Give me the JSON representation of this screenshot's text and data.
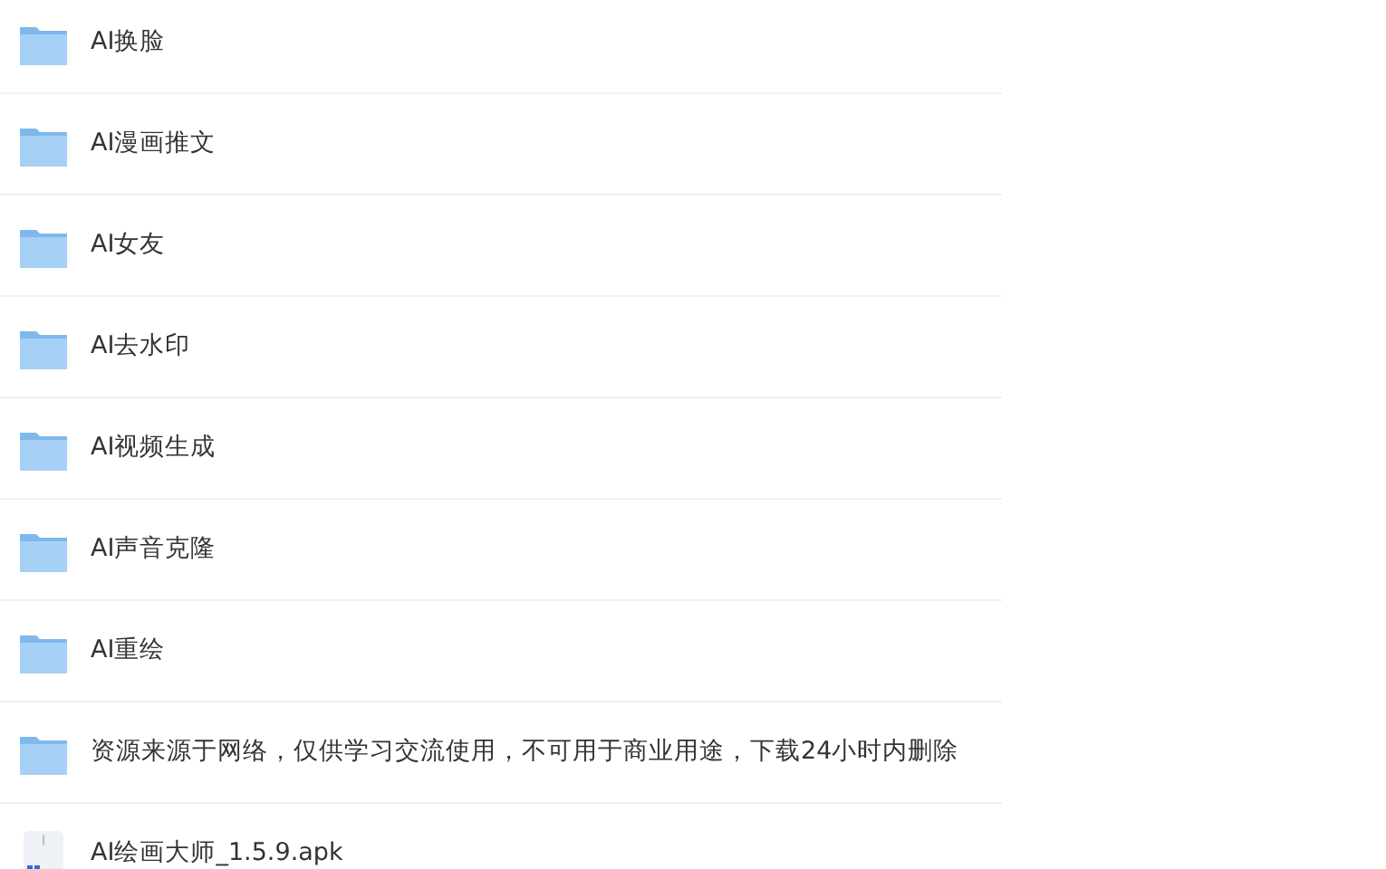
{
  "files": [
    {
      "kind": "folder",
      "name": "AI换脸"
    },
    {
      "kind": "folder",
      "name": "AI漫画推文"
    },
    {
      "kind": "folder",
      "name": "AI女友"
    },
    {
      "kind": "folder",
      "name": "AI去水印"
    },
    {
      "kind": "folder",
      "name": "AI视频生成"
    },
    {
      "kind": "folder",
      "name": "AI声音克隆"
    },
    {
      "kind": "folder",
      "name": "AI重绘"
    },
    {
      "kind": "folder",
      "name": "资源来源于网络，仅供学习交流使用，不可用于商业用途，下载24小时内删除"
    },
    {
      "kind": "apk",
      "name": "AI绘画大师_1.5.9.apk"
    }
  ]
}
